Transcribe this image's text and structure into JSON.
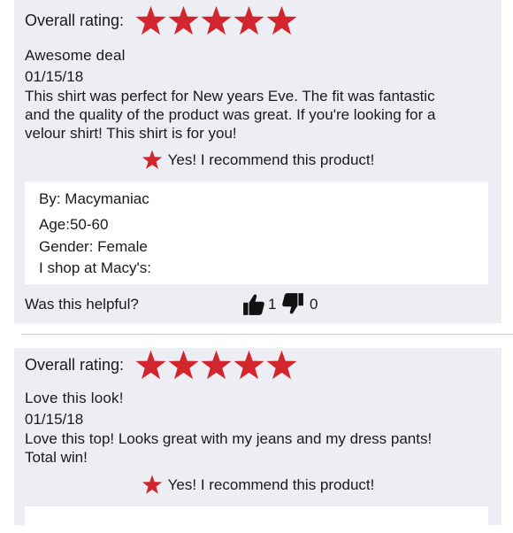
{
  "colors": {
    "accent_star": "#d3252d",
    "card_background": "#eceef4",
    "info_background": "#ffffff"
  },
  "reviews": [
    {
      "rating_label": "Overall rating:",
      "rating_stars": 5,
      "title": "Awesome deal",
      "date": "01/15/18",
      "body_lines": [
        "This shirt was perfect for New years Eve. The fit was fantastic",
        "and the quality of the product was great. If you're looking for a",
        "velour shirt! This shirt is for you!"
      ],
      "recommend_text": "Yes! I recommend this product!",
      "reviewer": {
        "by": "By: Macymaniac",
        "age": "Age:50-60",
        "gender": "Gender: Female",
        "shop": "I shop at Macy's:"
      },
      "helpful_label": "Was this helpful?",
      "thumbs_up_count": "1",
      "thumbs_down_count": "0"
    },
    {
      "rating_label": "Overall rating:",
      "rating_stars": 5,
      "title": "Love this look!",
      "date": "01/15/18",
      "body_lines": [
        "Love this top!  Looks great with my jeans and my dress pants!",
        "Total win!"
      ],
      "recommend_text": "Yes! I recommend this product!"
    }
  ]
}
